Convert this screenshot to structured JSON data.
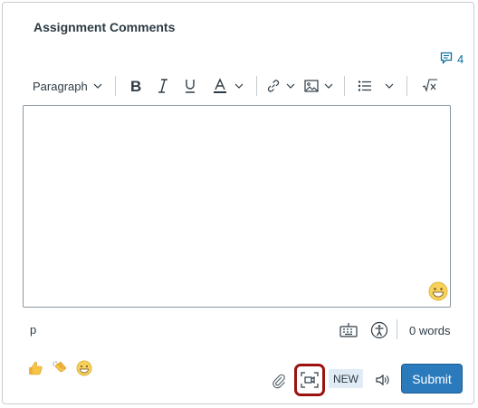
{
  "panel": {
    "title": "Assignment Comments",
    "comments_count": "4"
  },
  "toolbar": {
    "paragraph_label": "Paragraph",
    "icons": [
      "bold-icon",
      "italic-icon",
      "underline-icon",
      "text-color-icon",
      "link-icon",
      "image-icon",
      "list-icon",
      "math-icon"
    ]
  },
  "status_bar": {
    "path": "p",
    "word_count": "0 words"
  },
  "reactions": [
    "thumbs-up",
    "clapping-hands",
    "smiley"
  ],
  "actions": {
    "new_badge": "NEW",
    "submit_label": "Submit"
  },
  "colors": {
    "accent": "#2b7abc",
    "link": "#0770a3",
    "highlight_border": "#9c1212",
    "badge_bg": "#e0ebf5"
  }
}
